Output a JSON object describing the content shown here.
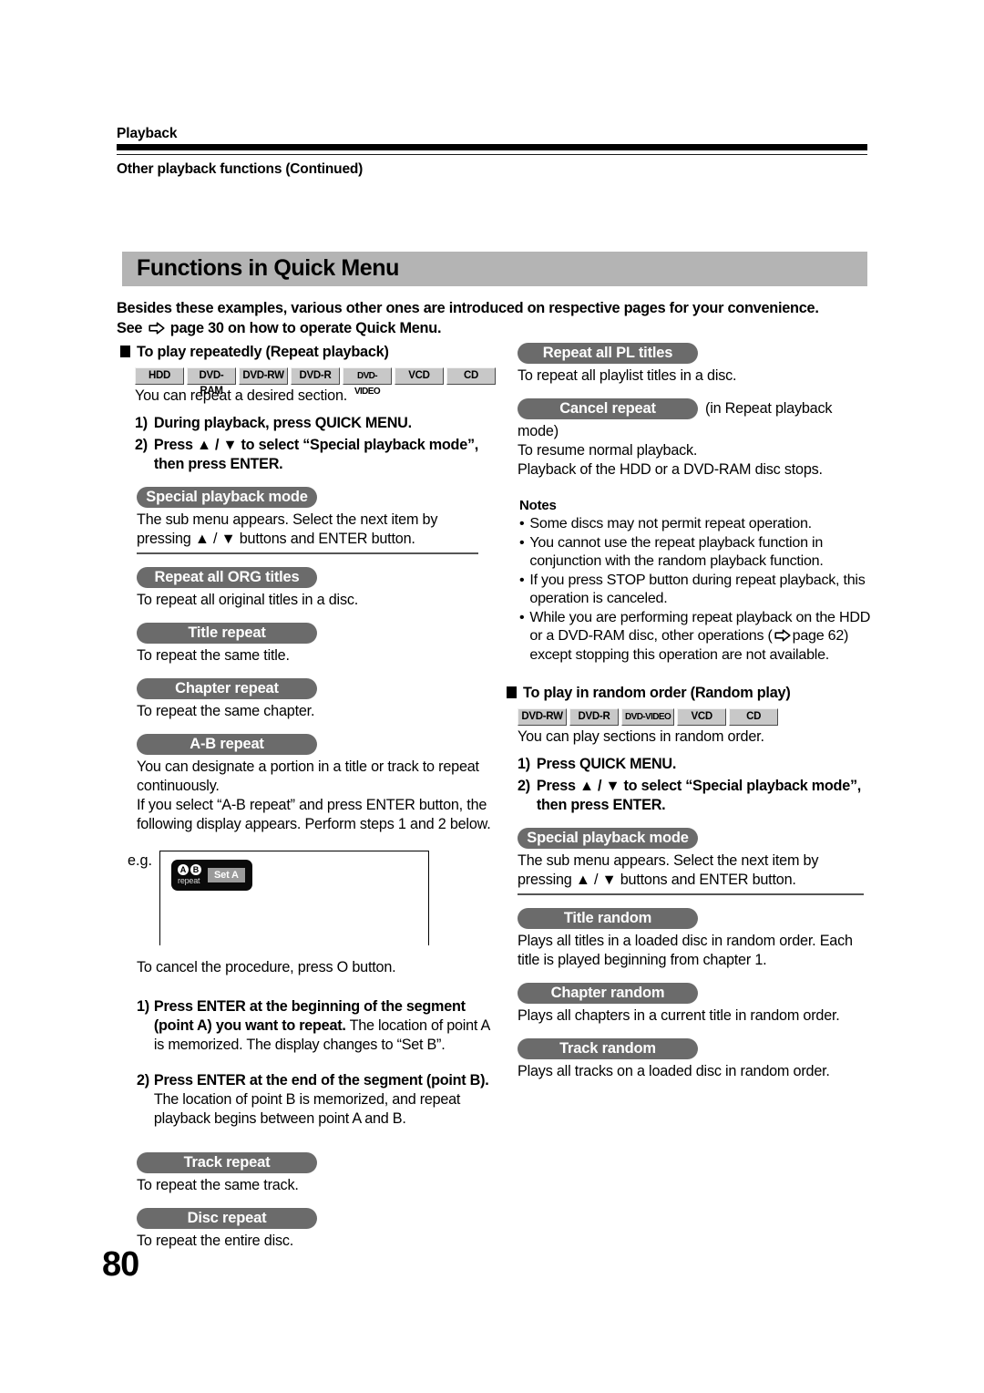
{
  "running_header": {
    "section": "Playback",
    "subsection": "Other playback functions (Continued)"
  },
  "section_title": "Functions in Quick Menu",
  "intro": {
    "line1": "Besides these examples, various other ones are introduced on respective pages for your convenience.",
    "line2_before": "See",
    "line2_after": "page 30 on how to operate Quick Menu.",
    "arrow_icon": "right-arrow-icon"
  },
  "left_column": {
    "heading": "To play repeatedly (Repeat playback)",
    "badges": [
      "HDD",
      "DVD-RAM",
      "DVD-RW",
      "DVD-R",
      "DVD-VIDEO",
      "VCD",
      "CD"
    ],
    "lead": "You can repeat a desired section.",
    "steps": [
      {
        "num": "1)",
        "text": "During playback, press QUICK MENU."
      },
      {
        "num": "2)",
        "text": "Press ▲ / ▼ to select “Special playback mode”, then press ENTER."
      }
    ],
    "special_mode": {
      "pill": "Special playback mode",
      "desc": "The sub menu appears. Select the next item by pressing ▲ / ▼ buttons and ENTER button."
    },
    "modes": [
      {
        "pill": "Repeat all ORG titles",
        "desc": "To repeat all original titles in a disc."
      },
      {
        "pill": "Title repeat",
        "desc": "To repeat the same title."
      },
      {
        "pill": "Chapter repeat",
        "desc": "To repeat the same chapter."
      }
    ],
    "ab_repeat": {
      "pill": "A-B repeat",
      "desc1": "You can designate a portion in a title or track to repeat continuously.",
      "desc2": "If you select “A-B repeat” and press ENTER button, the following display appears. Perform steps 1 and 2 below.",
      "eg_label": "e.g.",
      "osd": {
        "letter_a": "A",
        "letter_b": "B",
        "repeat_text": "repeat",
        "set_button": "Set A"
      },
      "cancel_note": "To cancel the procedure, press O button.",
      "procedure": [
        {
          "num": "1)",
          "head": "Press ENTER at the beginning of the segment (point A) you want to repeat.",
          "sub": "The location of point A is memorized. The display changes to “Set B”."
        },
        {
          "num": "2)",
          "head": "Press ENTER at the end of the segment (point B).",
          "sub": "The location of point B is memorized, and repeat playback begins between point A and B."
        }
      ]
    },
    "tail_modes": [
      {
        "pill": "Track repeat",
        "desc": "To repeat the same track."
      },
      {
        "pill": "Disc repeat",
        "desc": "To repeat the entire disc."
      }
    ]
  },
  "right_column": {
    "pl_titles": {
      "pill": "Repeat all PL titles",
      "desc": "To repeat all playlist titles in a disc."
    },
    "cancel_repeat": {
      "pill": "Cancel repeat",
      "after_pill": "(in Repeat playback",
      "desc": "mode)\nTo resume normal playback.\nPlayback of the HDD or a DVD-RAM disc stops."
    },
    "notes": {
      "title": "Notes",
      "items": [
        "Some discs may not permit repeat operation.",
        "You cannot use the repeat playback function in conjunction with the random playback function.",
        "If you press STOP button during repeat playback, this operation is canceled."
      ],
      "item4_part1": "While you are performing repeat playback on the HDD or a DVD-RAM disc, other operations (",
      "item4_part2": "page 62) except stopping this operation are not available.",
      "bullet": "•"
    },
    "random": {
      "heading": "To play in random order (Random play)",
      "badges": [
        "DVD-RW",
        "DVD-R",
        "DVD-VIDEO",
        "VCD",
        "CD"
      ],
      "lead": "You can play sections in random order.",
      "steps": [
        {
          "num": "1)",
          "text": "Press QUICK MENU."
        },
        {
          "num": "2)",
          "text": "Press ▲ / ▼ to select “Special playback mode”, then press ENTER."
        }
      ],
      "special_mode": {
        "pill": "Special playback mode",
        "desc": "The sub menu appears. Select the next item by pressing ▲ / ▼ buttons and ENTER button."
      },
      "modes": [
        {
          "pill": "Title random",
          "desc": "Plays all titles in a loaded disc in random order. Each title is played beginning from chapter 1."
        },
        {
          "pill": "Chapter random",
          "desc": "Plays all chapters in a current title in random order."
        },
        {
          "pill": "Track random",
          "desc": "Plays all tracks on a loaded disc in random order."
        }
      ]
    }
  },
  "page_number": "80",
  "colors": {
    "pill_bg": "#6b6b6b",
    "band_bg": "#b4b4b4",
    "badge_bg": "#c8c8c8",
    "osd_bg": "#0a0a0a"
  }
}
